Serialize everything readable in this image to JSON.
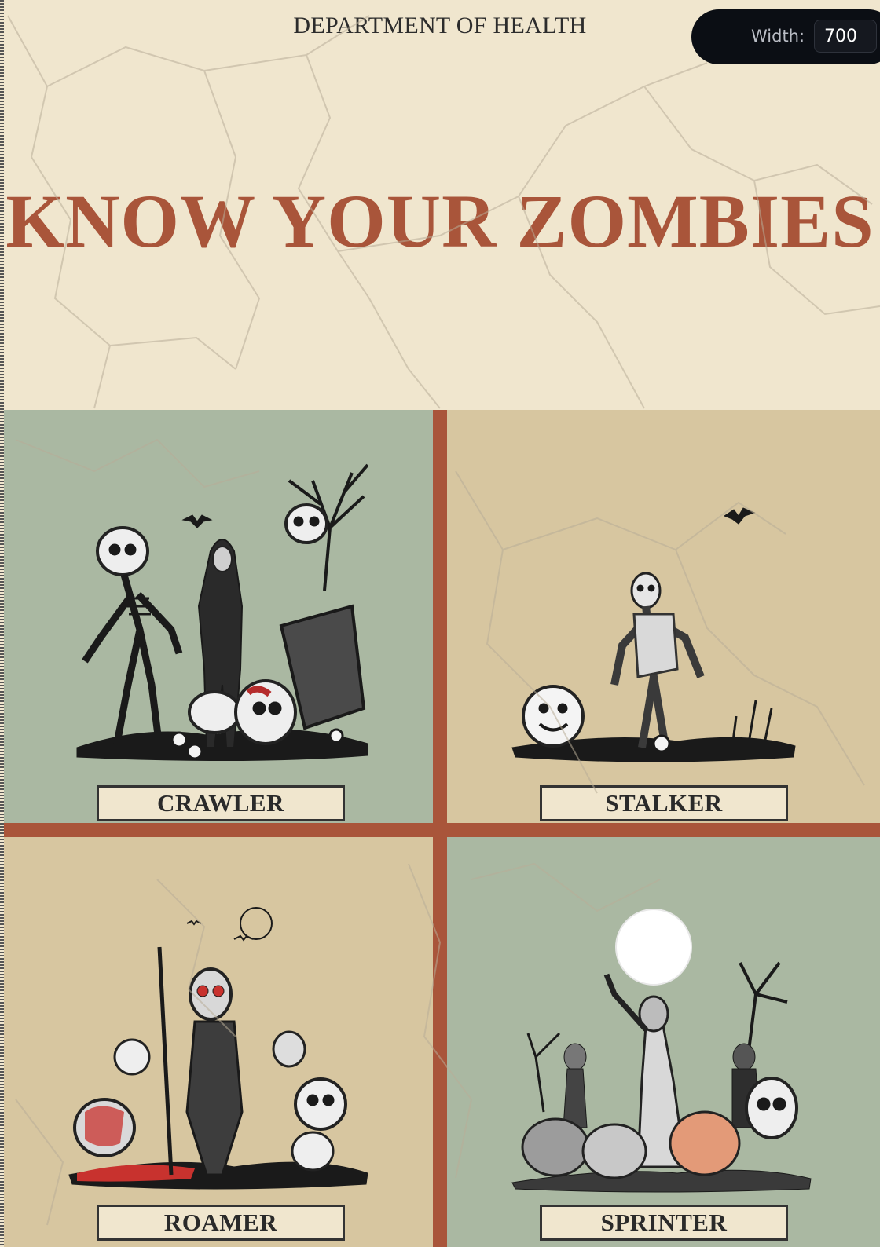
{
  "header": {
    "department": "DEPARTMENT OF HEALTH",
    "title": "KNOW YOUR ZOMBIES"
  },
  "width_control": {
    "label": "Width:",
    "value": "700"
  },
  "zombies": [
    {
      "label": "CRAWLER",
      "icon": "skeleton-zombies-illustration"
    },
    {
      "label": "STALKER",
      "icon": "lone-zombie-illustration"
    },
    {
      "label": "ROAMER",
      "icon": "zombie-horde-illustration"
    },
    {
      "label": "SPRINTER",
      "icon": "pumpkin-zombies-illustration"
    }
  ],
  "colors": {
    "paper": "#f0e6ce",
    "sage": "#aab8a2",
    "tan": "#d7c6a0",
    "rust": "#a9553a",
    "ink": "#2a2a2a"
  }
}
